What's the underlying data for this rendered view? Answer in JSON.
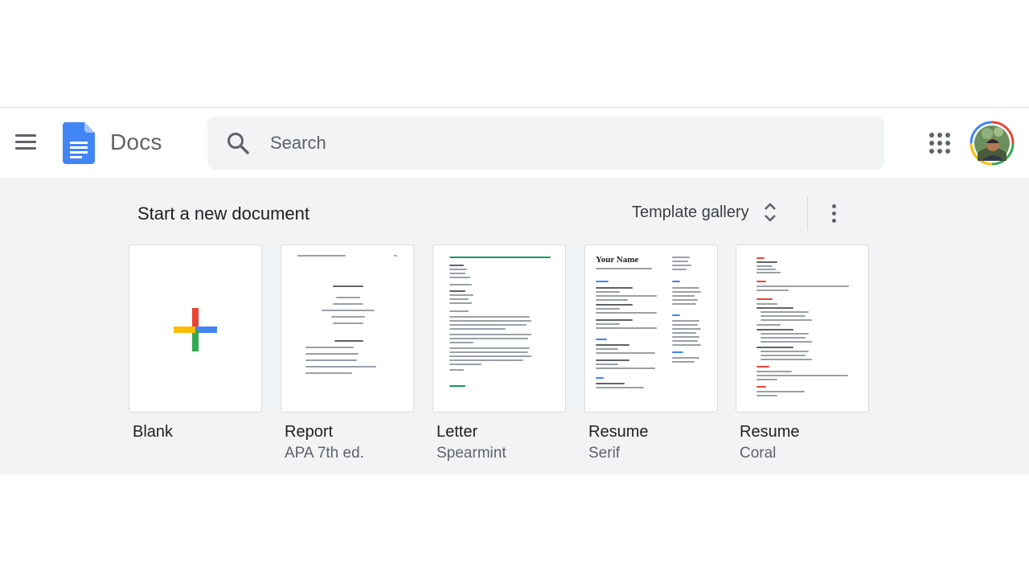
{
  "header": {
    "app_name": "Docs",
    "search": {
      "placeholder": "Search",
      "value": ""
    },
    "icons": {
      "menu": "hamburger-menu-icon",
      "logo": "google-docs-logo",
      "search": "search-icon",
      "apps": "google-apps-grid-icon"
    }
  },
  "templates": {
    "section_title": "Start a new document",
    "gallery_label": "Template gallery",
    "items": [
      {
        "title": "Blank",
        "subtitle": ""
      },
      {
        "title": "Report",
        "subtitle": "APA 7th ed."
      },
      {
        "title": "Letter",
        "subtitle": "Spearmint"
      },
      {
        "title": "Resume",
        "subtitle": "Serif"
      },
      {
        "title": "Resume",
        "subtitle": "Coral"
      }
    ],
    "thumbnail_text": {
      "resume_serif_name": "Your Name"
    }
  },
  "colors": {
    "docs_blue": "#4285f4",
    "google_red": "#ea4335",
    "google_yellow": "#fbbc04",
    "google_green": "#34a853",
    "spearmint_green": "#0f9d58",
    "coral": "#ea4335",
    "panel_bg": "#f1f3f4"
  }
}
